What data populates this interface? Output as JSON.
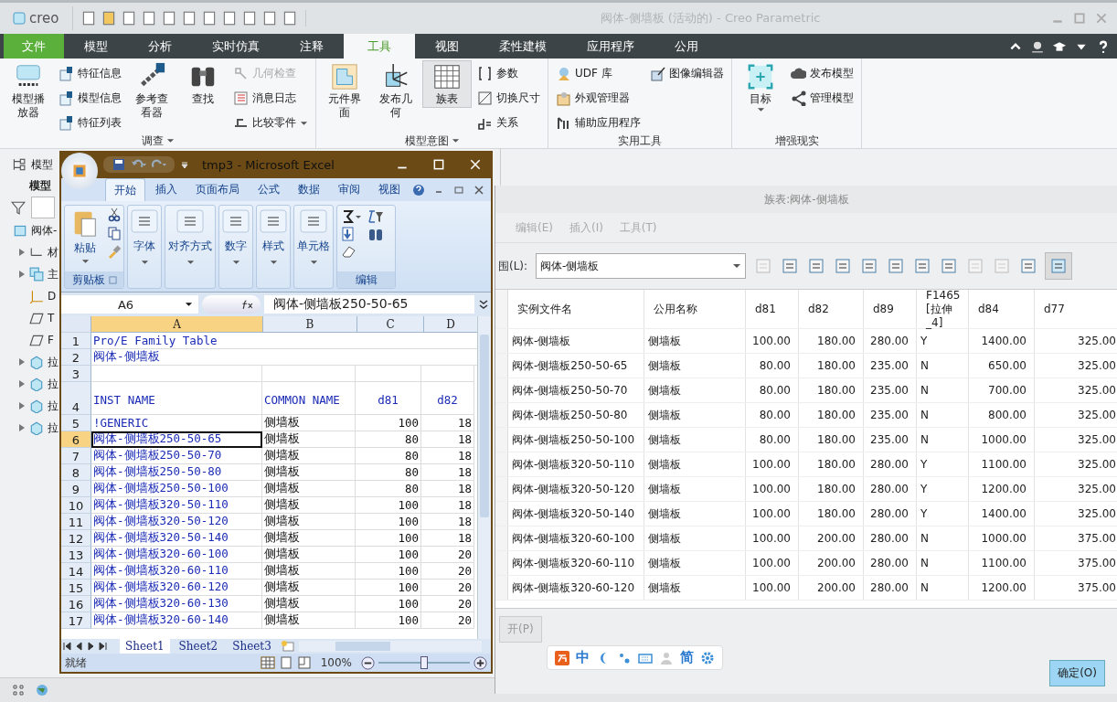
{
  "creo": {
    "logo": "creo",
    "title": "阀体-侧墙板 (活动的) - Creo Parametric",
    "tabs": [
      {
        "label": "文件",
        "kind": "file",
        "selected": false
      },
      {
        "label": "模型",
        "kind": "tab",
        "selected": false
      },
      {
        "label": "分析",
        "kind": "tab",
        "selected": false
      },
      {
        "label": "实时仿真",
        "kind": "tab",
        "selected": false
      },
      {
        "label": "注释",
        "kind": "tab",
        "selected": false
      },
      {
        "label": "工具",
        "kind": "tab",
        "selected": true
      },
      {
        "label": "视图",
        "kind": "tab",
        "selected": false
      },
      {
        "label": "柔性建模",
        "kind": "tab",
        "selected": false
      },
      {
        "label": "应用程序",
        "kind": "tab",
        "selected": false
      },
      {
        "label": "公用",
        "kind": "tab",
        "selected": false
      }
    ],
    "ribbon": [
      {
        "label": "调查",
        "dropdown": true,
        "columns": [
          {
            "kind": "large",
            "items": [
              {
                "label": "模型播放器",
                "disabled": false,
                "pressed": false,
                "dropdown": false
              }
            ]
          },
          {
            "kind": "small",
            "items": [
              {
                "label": "特征信息",
                "disabled": false,
                "pressed": false,
                "dropdown": false
              },
              {
                "label": "模型信息",
                "disabled": false,
                "pressed": false,
                "dropdown": false
              },
              {
                "label": "特征列表",
                "disabled": false,
                "pressed": false,
                "dropdown": false
              }
            ]
          },
          {
            "kind": "large",
            "items": [
              {
                "label": "参考查看器",
                "disabled": false,
                "pressed": false,
                "dropdown": false
              }
            ]
          },
          {
            "kind": "large",
            "items": [
              {
                "label": "查找",
                "disabled": false,
                "pressed": false,
                "dropdown": false
              }
            ]
          },
          {
            "kind": "small",
            "items": [
              {
                "label": "几何检查",
                "disabled": true,
                "pressed": false,
                "dropdown": false
              },
              {
                "label": "消息日志",
                "disabled": false,
                "pressed": false,
                "dropdown": false
              },
              {
                "label": "比较零件",
                "disabled": false,
                "pressed": false,
                "dropdown": true
              }
            ]
          }
        ]
      },
      {
        "label": "模型意图",
        "dropdown": true,
        "columns": [
          {
            "kind": "large",
            "items": [
              {
                "label": "元件界面",
                "disabled": false,
                "pressed": false,
                "dropdown": false
              }
            ]
          },
          {
            "kind": "large",
            "items": [
              {
                "label": "发布几何",
                "disabled": false,
                "pressed": false,
                "dropdown": false
              }
            ]
          },
          {
            "kind": "large",
            "items": [
              {
                "label": "族表",
                "disabled": false,
                "pressed": true,
                "dropdown": false
              }
            ]
          },
          {
            "kind": "small",
            "items": [
              {
                "label": "参数",
                "disabled": false,
                "pressed": false,
                "dropdown": false
              },
              {
                "label": "切换尺寸",
                "disabled": false,
                "pressed": false,
                "dropdown": false
              },
              {
                "label": "关系",
                "disabled": false,
                "pressed": false,
                "dropdown": false
              }
            ]
          }
        ]
      },
      {
        "label": "实用工具",
        "dropdown": false,
        "columns": [
          {
            "kind": "small",
            "items": [
              {
                "label": "UDF 库",
                "disabled": false,
                "pressed": false,
                "dropdown": false
              },
              {
                "label": "外观管理器",
                "disabled": false,
                "pressed": false,
                "dropdown": false
              },
              {
                "label": "辅助应用程序",
                "disabled": false,
                "pressed": false,
                "dropdown": false
              }
            ]
          },
          {
            "kind": "small",
            "items": [
              {
                "label": "图像编辑器",
                "disabled": false,
                "pressed": false,
                "dropdown": false
              }
            ]
          }
        ]
      },
      {
        "label": "增强现实",
        "dropdown": false,
        "columns": [
          {
            "kind": "large",
            "items": [
              {
                "label": "目标",
                "disabled": false,
                "pressed": false,
                "dropdown": true
              }
            ]
          },
          {
            "kind": "small",
            "items": [
              {
                "label": "发布模型",
                "disabled": false,
                "pressed": false,
                "dropdown": false
              },
              {
                "label": "管理模型",
                "disabled": false,
                "pressed": false,
                "dropdown": false
              }
            ]
          }
        ]
      }
    ],
    "tree": {
      "tab": "模型",
      "title": "模型",
      "items": [
        {
          "label": "阀体-",
          "kind": "part",
          "expandable": false
        },
        {
          "label": "材",
          "kind": "material",
          "expandable": true
        },
        {
          "label": "主",
          "kind": "body",
          "expandable": true
        },
        {
          "label": "D",
          "kind": "csys",
          "expandable": false
        },
        {
          "label": "T",
          "kind": "plane",
          "expandable": false
        },
        {
          "label": "F",
          "kind": "plane",
          "expandable": false
        },
        {
          "label": "拉",
          "kind": "feature",
          "expandable": true
        },
        {
          "label": "拉",
          "kind": "feature",
          "expandable": true
        },
        {
          "label": "拉",
          "kind": "feature",
          "expandable": true
        },
        {
          "label": "拉",
          "kind": "feature",
          "expandable": true
        }
      ]
    }
  },
  "family_table": {
    "title": "族表:阀体-侧墙板",
    "menu": [
      {
        "label": "编辑(E)",
        "disabled": true
      },
      {
        "label": "插入(I)",
        "disabled": true
      },
      {
        "label": "工具(T)",
        "disabled": true
      }
    ],
    "lookup": {
      "label": "围(L):",
      "value": "阀体-侧墙板"
    },
    "columns": [
      "实例文件名",
      "公用名称",
      "d81",
      "d82",
      "d89",
      "F1465 [拉伸_4]",
      "d84",
      "d77"
    ],
    "rows": [
      [
        "阀体-侧墙板",
        "侧墙板",
        "100.00",
        "180.00",
        "280.00",
        "Y",
        "1400.00",
        "325.00"
      ],
      [
        "阀体-侧墙板250-50-65",
        "侧墙板",
        "80.00",
        "180.00",
        "235.00",
        "N",
        "650.00",
        "325.00"
      ],
      [
        "阀体-侧墙板250-50-70",
        "侧墙板",
        "80.00",
        "180.00",
        "235.00",
        "N",
        "700.00",
        "325.00"
      ],
      [
        "阀体-侧墙板250-50-80",
        "侧墙板",
        "80.00",
        "180.00",
        "235.00",
        "N",
        "800.00",
        "325.00"
      ],
      [
        "阀体-侧墙板250-50-100",
        "侧墙板",
        "80.00",
        "180.00",
        "235.00",
        "N",
        "1000.00",
        "325.00"
      ],
      [
        "阀体-侧墙板320-50-110",
        "侧墙板",
        "100.00",
        "180.00",
        "280.00",
        "Y",
        "1100.00",
        "325.00"
      ],
      [
        "阀体-侧墙板320-50-120",
        "侧墙板",
        "100.00",
        "180.00",
        "280.00",
        "Y",
        "1200.00",
        "325.00"
      ],
      [
        "阀体-侧墙板320-50-140",
        "侧墙板",
        "100.00",
        "180.00",
        "280.00",
        "Y",
        "1400.00",
        "325.00"
      ],
      [
        "阀体-侧墙板320-60-100",
        "侧墙板",
        "100.00",
        "200.00",
        "280.00",
        "N",
        "1000.00",
        "375.00"
      ],
      [
        "阀体-侧墙板320-60-110",
        "侧墙板",
        "100.00",
        "200.00",
        "280.00",
        "N",
        "1100.00",
        "375.00"
      ],
      [
        "阀体-侧墙板320-60-120",
        "侧墙板",
        "100.00",
        "200.00",
        "280.00",
        "N",
        "1200.00",
        "375.00"
      ]
    ],
    "buttons": [
      {
        "label": "开(P)",
        "default": false
      },
      {
        "label": "确定(O)",
        "default": true
      }
    ]
  },
  "excel": {
    "title": "tmp3 - Microsoft Excel",
    "tabs": [
      {
        "label": "开始",
        "selected": true
      },
      {
        "label": "插入",
        "selected": false
      },
      {
        "label": "页面布局",
        "selected": false
      },
      {
        "label": "公式",
        "selected": false
      },
      {
        "label": "数据",
        "selected": false
      },
      {
        "label": "审阅",
        "selected": false
      },
      {
        "label": "视图",
        "selected": false
      }
    ],
    "groups": [
      {
        "kind": "clipboard",
        "label": "剪贴板",
        "button": "粘贴"
      },
      {
        "kind": "collapsed",
        "label": "字体"
      },
      {
        "kind": "collapsed",
        "label": "对齐方式"
      },
      {
        "kind": "collapsed",
        "label": "数字"
      },
      {
        "kind": "collapsed",
        "label": "样式"
      },
      {
        "kind": "collapsed",
        "label": "单元格"
      },
      {
        "kind": "editing",
        "label": "编辑"
      }
    ],
    "name_box": "A6",
    "formula": "阀体-侧墙板250-50-65",
    "columns": [
      {
        "label": "A",
        "selected": true
      },
      {
        "label": "B",
        "selected": false
      },
      {
        "label": "C",
        "selected": false
      },
      {
        "label": "D",
        "selected": false
      }
    ],
    "rows": [
      {
        "num": "1",
        "kind": "title",
        "selected": false,
        "cells": [
          "Pro/E Family Table"
        ]
      },
      {
        "num": "2",
        "kind": "title",
        "selected": false,
        "cells": [
          "阀体-侧墙板"
        ]
      },
      {
        "num": "3",
        "kind": "blank",
        "selected": false,
        "cells": []
      },
      {
        "num": "4",
        "kind": "header",
        "selected": false,
        "cells": [
          "INST NAME",
          "COMMON NAME",
          "d81",
          "d82"
        ]
      },
      {
        "num": "5",
        "kind": "data",
        "selected": false,
        "cells": [
          "!GENERIC",
          "侧墙板",
          "100",
          "18"
        ]
      },
      {
        "num": "6",
        "kind": "data",
        "selected": true,
        "cells": [
          "阀体-侧墙板250-50-65",
          "侧墙板",
          "80",
          "18"
        ]
      },
      {
        "num": "7",
        "kind": "data",
        "selected": false,
        "cells": [
          "阀体-侧墙板250-50-70",
          "侧墙板",
          "80",
          "18"
        ]
      },
      {
        "num": "8",
        "kind": "data",
        "selected": false,
        "cells": [
          "阀体-侧墙板250-50-80",
          "侧墙板",
          "80",
          "18"
        ]
      },
      {
        "num": "9",
        "kind": "data",
        "selected": false,
        "cells": [
          "阀体-侧墙板250-50-100",
          "侧墙板",
          "80",
          "18"
        ]
      },
      {
        "num": "10",
        "kind": "data",
        "selected": false,
        "cells": [
          "阀体-侧墙板320-50-110",
          "侧墙板",
          "100",
          "18"
        ]
      },
      {
        "num": "11",
        "kind": "data",
        "selected": false,
        "cells": [
          "阀体-侧墙板320-50-120",
          "侧墙板",
          "100",
          "18"
        ]
      },
      {
        "num": "12",
        "kind": "data",
        "selected": false,
        "cells": [
          "阀体-侧墙板320-50-140",
          "侧墙板",
          "100",
          "18"
        ]
      },
      {
        "num": "13",
        "kind": "data",
        "selected": false,
        "cells": [
          "阀体-侧墙板320-60-100",
          "侧墙板",
          "100",
          "20"
        ]
      },
      {
        "num": "14",
        "kind": "data",
        "selected": false,
        "cells": [
          "阀体-侧墙板320-60-110",
          "侧墙板",
          "100",
          "20"
        ]
      },
      {
        "num": "15",
        "kind": "data",
        "selected": false,
        "cells": [
          "阀体-侧墙板320-60-120",
          "侧墙板",
          "100",
          "20"
        ]
      },
      {
        "num": "16",
        "kind": "data",
        "selected": false,
        "cells": [
          "阀体-侧墙板320-60-130",
          "侧墙板",
          "100",
          "20"
        ]
      },
      {
        "num": "17",
        "kind": "data",
        "selected": false,
        "cells": [
          "阀体-侧墙板320-60-140",
          "侧墙板",
          "100",
          "20"
        ]
      }
    ],
    "sheets": [
      {
        "label": "Sheet1",
        "selected": true
      },
      {
        "label": "Sheet2",
        "selected": false
      },
      {
        "label": "Sheet3",
        "selected": false
      }
    ],
    "status": "就绪",
    "zoom": "100%",
    "zoom_slider": {
      "level": 0.5
    }
  },
  "ime": {
    "mode": "中",
    "script": "简"
  }
}
